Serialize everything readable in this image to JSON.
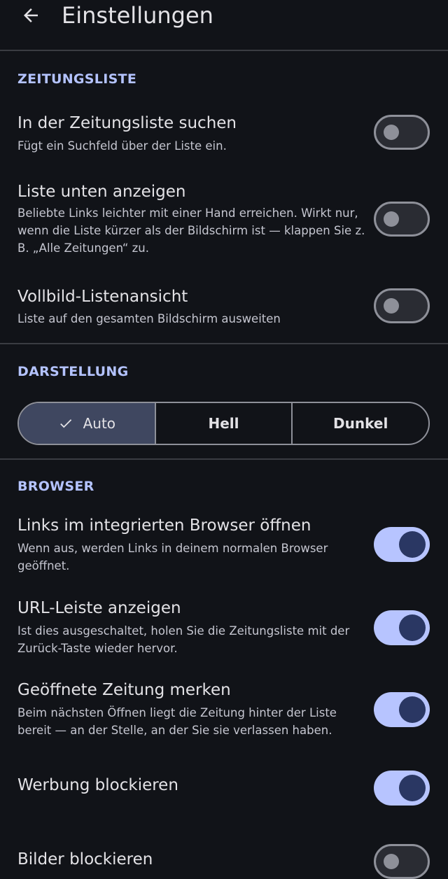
{
  "header": {
    "title": "Einstellungen",
    "back_icon": "arrow-back-icon"
  },
  "sections": {
    "newspaper_list": "ZEITUNGSLISTE",
    "appearance": "DARSTELLUNG",
    "browser": "BROWSER"
  },
  "settings": {
    "search_list": {
      "title": "In der Zeitungsliste suchen",
      "desc": "Fügt ein Suchfeld über der Liste ein.",
      "enabled": false
    },
    "list_bottom": {
      "title": "Liste unten anzeigen",
      "desc": "Beliebte Links leichter mit einer Hand erreichen. Wirkt nur, wenn die Liste kürzer als der Bildschirm ist — klappen Sie z. B. „Alle Zeitungen“ zu.",
      "enabled": false
    },
    "fullscreen_list": {
      "title": "Vollbild-Listenansicht",
      "desc": "Liste auf den gesamten Bildschirm ausweiten",
      "enabled": false
    },
    "internal_browser": {
      "title": "Links im integrierten Browser öffnen",
      "desc": "Wenn aus, werden Links in deinem normalen Browser geöffnet.",
      "enabled": true
    },
    "url_bar": {
      "title": "URL-Leiste anzeigen",
      "desc": "Ist dies ausgeschaltet, holen Sie die Zeitungsliste mit der Zurück-Taste wieder hervor.",
      "enabled": true
    },
    "remember_paper": {
      "title": "Geöffnete Zeitung merken",
      "desc": "Beim nächsten Öffnen liegt die Zeitung hinter der Liste bereit — an der Stelle, an der Sie sie verlassen haben.",
      "enabled": true
    },
    "block_ads": {
      "title": "Werbung blockieren",
      "enabled": true
    },
    "block_images": {
      "title": "Bilder blockieren",
      "enabled": false
    }
  },
  "theme": {
    "options": [
      "Auto",
      "Hell",
      "Dunkel"
    ],
    "selected": "Auto"
  },
  "colors": {
    "background": "#111318",
    "accent": "#b4c3ff",
    "switch_on_track": "#b7c4ff",
    "switch_on_thumb": "#2a3763",
    "segment_selected": "#3f4760"
  }
}
